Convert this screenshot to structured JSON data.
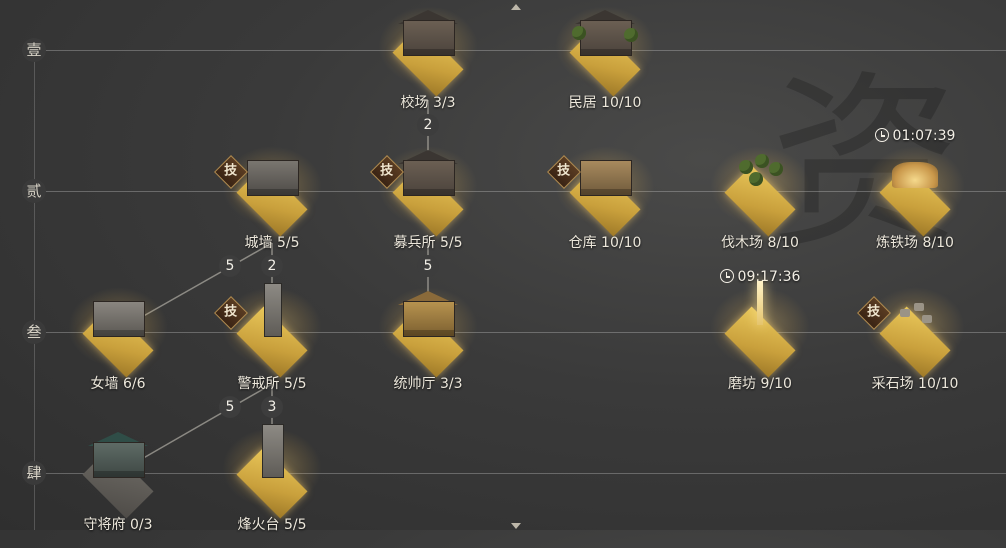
{
  "background_glyph": "资",
  "rows": [
    "壹",
    "贰",
    "叁",
    "肆"
  ],
  "tech_badge": "技",
  "links": [
    {
      "label": "2"
    },
    {
      "label": "5"
    },
    {
      "label": "2"
    },
    {
      "label": "5"
    },
    {
      "label": "5"
    },
    {
      "label": "3"
    }
  ],
  "buildings": [
    {
      "name": "校场",
      "level": "3/3",
      "tech": false
    },
    {
      "name": "民居",
      "level": "10/10",
      "tech": false
    },
    {
      "name": "城墙",
      "level": "5/5",
      "tech": true
    },
    {
      "name": "募兵所",
      "level": "5/5",
      "tech": true
    },
    {
      "name": "仓库",
      "level": "10/10",
      "tech": true
    },
    {
      "name": "伐木场",
      "level": "8/10",
      "tech": false
    },
    {
      "name": "炼铁场",
      "level": "8/10",
      "tech": false,
      "timer": "01:07:39"
    },
    {
      "name": "女墙",
      "level": "6/6",
      "tech": false
    },
    {
      "name": "警戒所",
      "level": "5/5",
      "tech": true
    },
    {
      "name": "统帅厅",
      "level": "3/3",
      "tech": false
    },
    {
      "name": "磨坊",
      "level": "9/10",
      "tech": false,
      "timer": "09:17:36"
    },
    {
      "name": "采石场",
      "level": "10/10",
      "tech": true
    },
    {
      "name": "守将府",
      "level": "0/3",
      "tech": false
    },
    {
      "name": "烽火台",
      "level": "5/5",
      "tech": false
    }
  ],
  "icons": {
    "clock": "clock-icon",
    "nav_up": "arrow-up-icon",
    "nav_down": "arrow-down-icon"
  }
}
